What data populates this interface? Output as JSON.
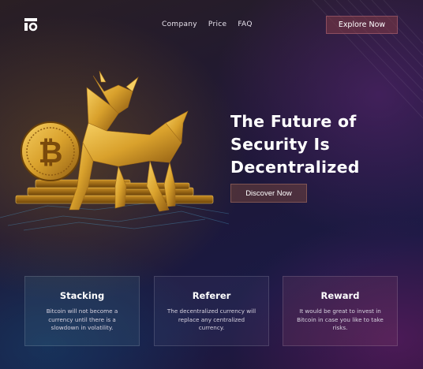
{
  "header": {
    "nav": [
      "Company",
      "Price",
      "FAQ"
    ],
    "cta_label": "Explore Now"
  },
  "hero": {
    "title": "The Future of\nSecurity Is\nDecentralized",
    "button_label": "Discover Now",
    "coin_symbol": "₿"
  },
  "features": [
    {
      "title": "Stacking",
      "text": "Bitcoin will not become a currency until there is a slowdown in volatility."
    },
    {
      "title": "Referer",
      "text": "The decentralized currency will replace any centralized currency."
    },
    {
      "title": "Reward",
      "text": "It would be great to invest in Bitcoin in case you like to take risks."
    }
  ],
  "colors": {
    "gold": "#d9a12c",
    "accent_button": "#823a46",
    "background": "#1d1736"
  },
  "icons": {
    "logo": "brand-logo-icon",
    "coin": "bitcoin-coin-icon",
    "bull": "golden-bull-illustration"
  }
}
